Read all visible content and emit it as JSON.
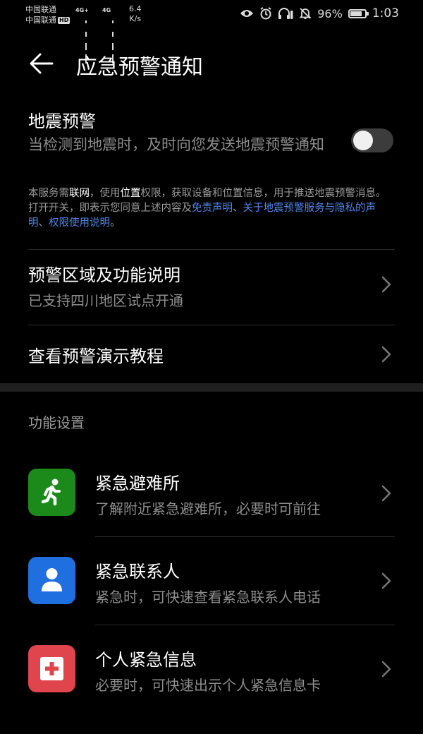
{
  "status_bar": {
    "carrier1": "中国联通",
    "carrier2": "中国联通",
    "hd_badge": "HD",
    "network1": "4G+",
    "network2": "4G",
    "speed_value": "6.4",
    "speed_unit": "K/s",
    "battery_percent": "96%",
    "battery_level": 0.96,
    "time": "1:03",
    "icons": [
      "eye-icon",
      "alarm-icon",
      "headphones-battery-icon",
      "mute-bell-icon",
      "battery-icon"
    ]
  },
  "header": {
    "title": "应急预警通知"
  },
  "earthquake": {
    "title": "地震预警",
    "description": "当检测到地震时，及时向您发送地震预警通知",
    "toggle_on": false
  },
  "notice": {
    "p1": "本服务需",
    "hl1": "联网",
    "p2": "，使用",
    "hl2": "位置",
    "p3": "权限，获取设备和位置信息，用于推送地震预警消息。打开开关，即表示您同意上述内容及",
    "link1": "免责声明",
    "p4": "、",
    "link2": "关于地震预警服务与隐私的声明",
    "p5": "、",
    "link3": "权限使用说明",
    "p6": "。"
  },
  "rows": [
    {
      "title": "预警区域及功能说明",
      "subtitle": "已支持四川地区试点开通"
    },
    {
      "title": "查看预警演示教程"
    }
  ],
  "feature_section": {
    "label": "功能设置",
    "items": [
      {
        "title": "紧急避难所",
        "subtitle": "了解附近紧急避难所，必要时可前往",
        "icon": "running-person-icon",
        "color": "#1b8a1b"
      },
      {
        "title": "紧急联系人",
        "subtitle": "紧急时，可快速查看紧急联系人电话",
        "icon": "contact-person-icon",
        "color": "#1f6fe0"
      },
      {
        "title": "个人紧急信息",
        "subtitle": "必要时，可快速出示个人紧急信息卡",
        "icon": "medical-cross-icon",
        "color": "#e0444c"
      }
    ]
  }
}
